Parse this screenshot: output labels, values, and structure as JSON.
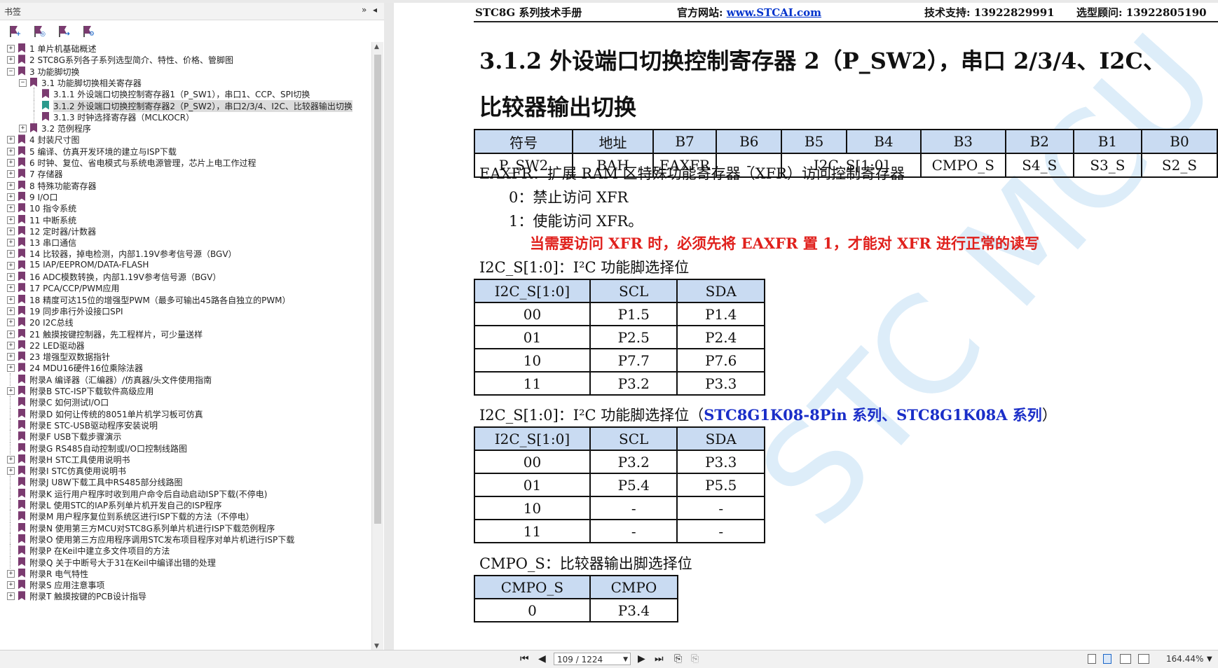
{
  "sidebar": {
    "title": "书签",
    "collapse_glyph": "»",
    "arrow_glyph": "◂",
    "tools": [
      "bookmark-expand-icon",
      "bookmark-search-icon",
      "bookmark-goto-icon",
      "bookmark-options-icon"
    ],
    "items": [
      {
        "label": "1 单片机基础概述",
        "level": 0,
        "expander": "+"
      },
      {
        "label": "2  STC8G系列各子系列选型简介、特性、价格、管脚图",
        "level": 0,
        "expander": "+"
      },
      {
        "label": "3  功能脚切换",
        "level": 0,
        "expander": "−"
      },
      {
        "label": "3.1 功能脚切换相关寄存器",
        "level": 1,
        "expander": "−"
      },
      {
        "label": "3.1.1 外设端口切换控制寄存器1（P_SW1），串口1、CCP、SPI切换",
        "level": 2,
        "expander": ""
      },
      {
        "label": "3.1.2  外设端口切换控制寄存器2（P_SW2），串口2/3/4、I2C、比较器输出切换",
        "level": 2,
        "expander": "",
        "selected": true
      },
      {
        "label": "3.1.3  时钟选择寄存器（MCLKOCR）",
        "level": 2,
        "expander": ""
      },
      {
        "label": "3.2  范例程序",
        "level": 1,
        "expander": "+"
      },
      {
        "label": "4  封装尺寸图",
        "level": 0,
        "expander": "+"
      },
      {
        "label": "5  编译、仿真开发环境的建立与ISP下载",
        "level": 0,
        "expander": "+"
      },
      {
        "label": "6  时钟、复位、省电模式与系统电源管理，芯片上电工作过程",
        "level": 0,
        "expander": "+"
      },
      {
        "label": "7  存储器",
        "level": 0,
        "expander": "+"
      },
      {
        "label": "8  特殊功能寄存器",
        "level": 0,
        "expander": "+"
      },
      {
        "label": "9  I/O口",
        "level": 0,
        "expander": "+"
      },
      {
        "label": "10  指令系统",
        "level": 0,
        "expander": "+"
      },
      {
        "label": "11  中断系统",
        "level": 0,
        "expander": "+"
      },
      {
        "label": "12  定时器/计数器",
        "level": 0,
        "expander": "+"
      },
      {
        "label": "13  串口通信",
        "level": 0,
        "expander": "+"
      },
      {
        "label": "14  比较器，掉电检测，内部1.19V参考信号源（BGV）",
        "level": 0,
        "expander": "+"
      },
      {
        "label": "15  IAP/EEPROM/DATA-FLASH",
        "level": 0,
        "expander": "+"
      },
      {
        "label": "16  ADC模数转换，内部1.19V参考信号源（BGV）",
        "level": 0,
        "expander": "+"
      },
      {
        "label": "17  PCA/CCP/PWM应用",
        "level": 0,
        "expander": "+"
      },
      {
        "label": "18  精度可达15位的增强型PWM（最多可输出45路各自独立的PWM）",
        "level": 0,
        "expander": "+"
      },
      {
        "label": "19  同步串行外设接口SPI",
        "level": 0,
        "expander": "+"
      },
      {
        "label": "20  I2C总线",
        "level": 0,
        "expander": "+"
      },
      {
        "label": "21  触摸按键控制器，先工程样片，可少量送样",
        "level": 0,
        "expander": "+"
      },
      {
        "label": "22  LED驱动器",
        "level": 0,
        "expander": "+"
      },
      {
        "label": "23  增强型双数据指针",
        "level": 0,
        "expander": "+"
      },
      {
        "label": "24  MDU16硬件16位乘除法器",
        "level": 0,
        "expander": "+"
      },
      {
        "label": "附录A  编译器（汇编器）/仿真器/头文件使用指南",
        "level": 0,
        "expander": ""
      },
      {
        "label": "附录B  STC-ISP下载软件高级应用",
        "level": 0,
        "expander": "+"
      },
      {
        "label": "附录C  如何测试I/O口",
        "level": 0,
        "expander": ""
      },
      {
        "label": "附录D  如何让传统的8051单片机学习板可仿真",
        "level": 0,
        "expander": ""
      },
      {
        "label": "附录E  STC-USB驱动程序安装说明",
        "level": 0,
        "expander": ""
      },
      {
        "label": "附录F  USB下载步骤演示",
        "level": 0,
        "expander": ""
      },
      {
        "label": "附录G  RS485自动控制或I/O口控制线路图",
        "level": 0,
        "expander": ""
      },
      {
        "label": "附录H  STC工具使用说明书",
        "level": 0,
        "expander": "+"
      },
      {
        "label": "附录I  STC仿真使用说明书",
        "level": 0,
        "expander": "+"
      },
      {
        "label": "附录J  U8W下载工具中RS485部分线路图",
        "level": 0,
        "expander": ""
      },
      {
        "label": "附录K  运行用户程序时收到用户命令后自动启动ISP下载(不停电)",
        "level": 0,
        "expander": ""
      },
      {
        "label": "附录L  使用STC的IAP系列单片机开发自己的ISP程序",
        "level": 0,
        "expander": ""
      },
      {
        "label": "附录M  用户程序复位到系统区进行ISP下载的方法（不停电）",
        "level": 0,
        "expander": ""
      },
      {
        "label": "附录N  使用第三方MCU对STC8G系列单片机进行ISP下载范例程序",
        "level": 0,
        "expander": ""
      },
      {
        "label": "附录O  使用第三方应用程序调用STC发布项目程序对单片机进行ISP下载",
        "level": 0,
        "expander": ""
      },
      {
        "label": "附录P  在Keil中建立多文件项目的方法",
        "level": 0,
        "expander": ""
      },
      {
        "label": "附录Q  关于中断号大于31在Keil中编译出错的处理",
        "level": 0,
        "expander": ""
      },
      {
        "label": "附录R  电气特性",
        "level": 0,
        "expander": "+"
      },
      {
        "label": "附录S  应用注意事项",
        "level": 0,
        "expander": "+"
      },
      {
        "label": "附录T  触摸按键的PCB设计指导",
        "level": 0,
        "expander": "+"
      }
    ]
  },
  "header": {
    "manual": "STC8G 系列技术手册",
    "site_label": "官方网站:",
    "site_url": "www.STCAI.com",
    "support": "技术支持: 13922829991",
    "advisor": "选型顾问: 13922805190"
  },
  "section": {
    "title_line1": "3.1.2      外设端口切换控制寄存器 2（P_SW2），串口 2/3/4、I2C、",
    "title_line2": "比较器输出切换"
  },
  "reg_table": {
    "headers": [
      "符号",
      "地址",
      "B7",
      "B6",
      "B5",
      "B4",
      "B3",
      "B2",
      "B1",
      "B0"
    ],
    "row": [
      "P_SW2",
      "BAH",
      "EAXFR",
      "-",
      "I2C_S[1:0]",
      "CMPO_S",
      "S4_S",
      "S3_S",
      "S2_S"
    ]
  },
  "eaxfr": {
    "desc": "EAXFR：扩展 RAM 区特殊功能寄存器（XFR）访问控制寄存器",
    "opt0": "0：禁止访问 XFR",
    "opt1": "1：使能访问 XFR。",
    "warning": "当需要访问 XFR 时，必须先将 EAXFR 置 1，才能对 XFR 进行正常的读写"
  },
  "i2c_table1": {
    "caption": "I2C_S[1:0]：I²C 功能脚选择位",
    "headers": [
      "I2C_S[1:0]",
      "SCL",
      "SDA"
    ],
    "rows": [
      [
        "00",
        "P1.5",
        "P1.4"
      ],
      [
        "01",
        "P2.5",
        "P2.4"
      ],
      [
        "10",
        "P7.7",
        "P7.6"
      ],
      [
        "11",
        "P3.2",
        "P3.3"
      ]
    ]
  },
  "i2c_table2": {
    "caption_prefix": "I2C_S[1:0]：I²C 功能脚选择位（",
    "caption_highlight": "STC8G1K08-8Pin 系列、STC8G1K08A 系列",
    "caption_suffix": "）",
    "headers": [
      "I2C_S[1:0]",
      "SCL",
      "SDA"
    ],
    "rows": [
      [
        "00",
        "P3.2",
        "P3.3"
      ],
      [
        "01",
        "P5.4",
        "P5.5"
      ],
      [
        "10",
        "-",
        "-"
      ],
      [
        "11",
        "-",
        "-"
      ]
    ]
  },
  "cmpo_table": {
    "caption": "CMPO_S：比较器输出脚选择位",
    "headers": [
      "CMPO_S",
      "CMPO"
    ],
    "rows": [
      [
        "0",
        "P3.4"
      ]
    ]
  },
  "watermark": "STC MCU",
  "toolbar": {
    "page": "109 / 1224",
    "zoom": "164.44%"
  }
}
